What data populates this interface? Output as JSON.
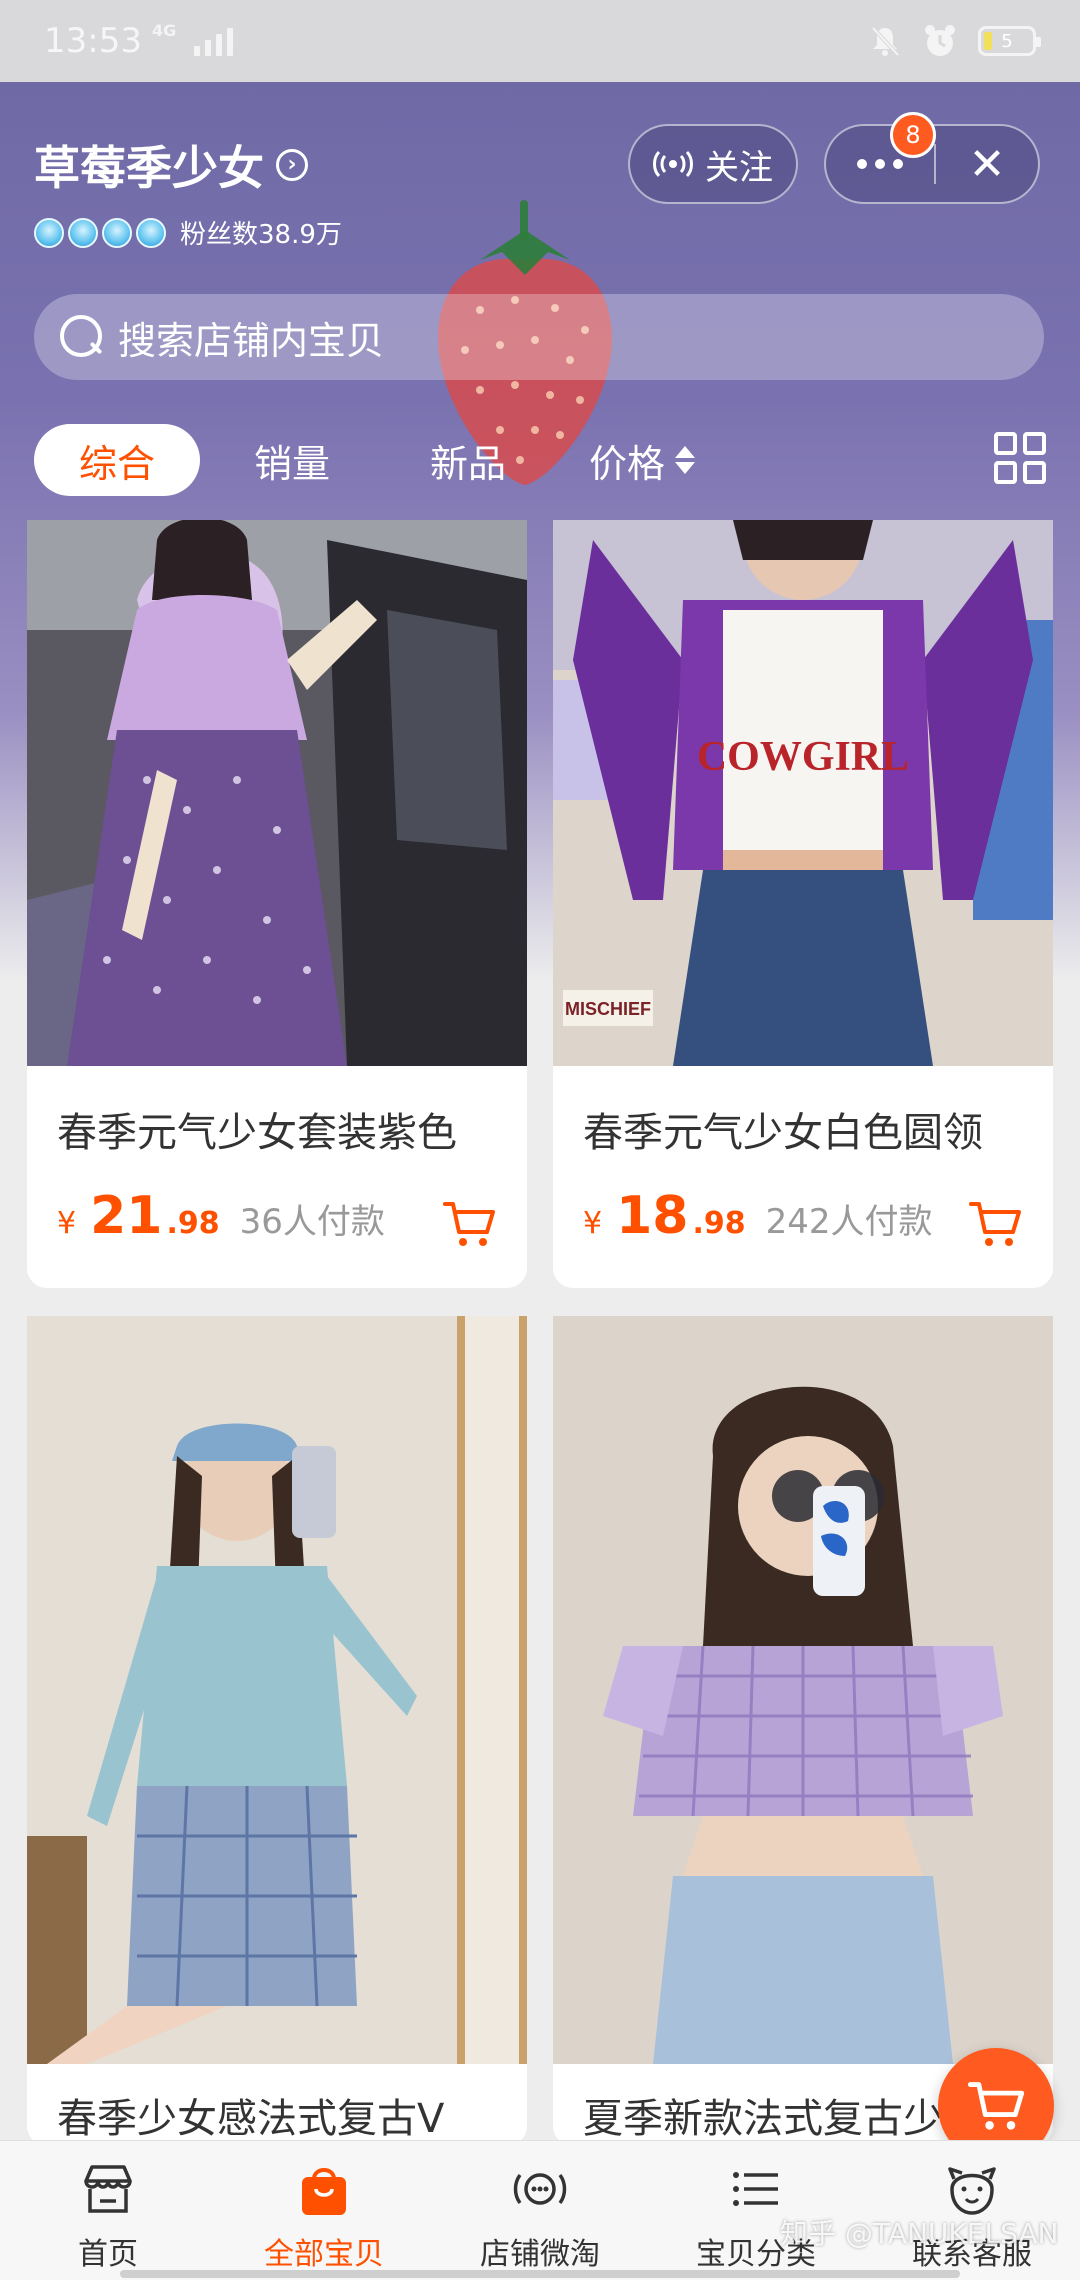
{
  "status_bar": {
    "time": "13:53",
    "network": "4G",
    "battery": "5"
  },
  "shop": {
    "name": "草莓季少女",
    "fans": "粉丝数38.9万",
    "follow_label": "关注",
    "notification_count": "8",
    "search_placeholder": "搜索店铺内宝贝"
  },
  "sort_tabs": [
    {
      "label": "综合",
      "active": true
    },
    {
      "label": "销量",
      "active": false
    },
    {
      "label": "新品",
      "active": false
    },
    {
      "label": "价格",
      "active": false
    }
  ],
  "products": [
    {
      "title": "春季元气少女套装紫色",
      "currency": "¥",
      "price_int": "21",
      "price_dec": ".98",
      "sold": "36人付款"
    },
    {
      "title": "春季元气少女白色圆领",
      "currency": "¥",
      "price_int": "18",
      "price_dec": ".98",
      "sold": "242人付款"
    },
    {
      "title": "春季少女感法式复古V",
      "currency": "",
      "price_int": "",
      "price_dec": "",
      "sold": ""
    },
    {
      "title": "夏季新款法式复古少",
      "currency": "",
      "price_int": "",
      "price_dec": "",
      "sold": ""
    }
  ],
  "photo_texts": {
    "cowgirl": "COWGIRL",
    "mischief": "MISCHIEF"
  },
  "bottom_nav": [
    {
      "label": "首页",
      "icon": "shop-icon",
      "active": false
    },
    {
      "label": "全部宝贝",
      "icon": "bag-icon",
      "active": true
    },
    {
      "label": "店铺微淘",
      "icon": "broadcast-icon",
      "active": false
    },
    {
      "label": "宝贝分类",
      "icon": "list-icon",
      "active": false
    },
    {
      "label": "联系客服",
      "icon": "service-icon",
      "active": false
    }
  ],
  "watermark": "知乎 @TANUKELSAN",
  "colors": {
    "accent": "#ff5000",
    "header": "#6f6aa6",
    "float_cart": "#ff5a1f"
  }
}
